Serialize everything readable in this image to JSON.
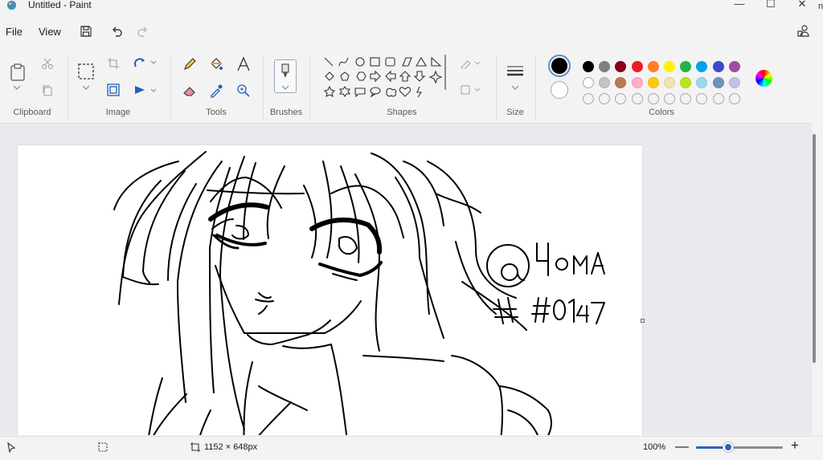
{
  "window": {
    "title": "Untitled - Paint",
    "minimize_glyph": "—",
    "maximize_glyph": "☐",
    "close_glyph": "✕",
    "edge_glyph": "n"
  },
  "menu": {
    "file": "File",
    "view": "View"
  },
  "ribbon": {
    "groups": {
      "clipboard": "Clipboard",
      "image": "Image",
      "tools": "Tools",
      "brushes": "Brushes",
      "shapes": "Shapes",
      "size": "Size",
      "colors": "Colors"
    },
    "shapes": [
      "line",
      "curve",
      "oval",
      "rectangle",
      "rounded-rectangle",
      "polygon",
      "triangle",
      "right-triangle",
      "diamond",
      "pentagon",
      "hexagon",
      "right-arrow",
      "left-arrow",
      "up-arrow",
      "down-arrow",
      "four-point-star",
      "five-point-star",
      "six-point-star",
      "rounded-callout",
      "oval-callout",
      "cloud-callout",
      "heart",
      "lightning"
    ],
    "colors": {
      "primary": "#000000",
      "secondary": "#ffffff",
      "palette_row1": [
        "#000000",
        "#7f7f7f",
        "#880015",
        "#ed1c24",
        "#ff7f27",
        "#fff200",
        "#22b14c",
        "#00a2e8",
        "#3f48cc",
        "#a349a4"
      ],
      "palette_row2": [
        "#ffffff",
        "#c3c3c3",
        "#b97a57",
        "#ffaec9",
        "#ffc90e",
        "#efe4b0",
        "#b5e61d",
        "#99d9ea",
        "#7092be",
        "#c8bfe7"
      ],
      "row2_empty_count": 0,
      "row3_empty_count": 10
    }
  },
  "canvas": {
    "signature_text": "@YoMA #0147"
  },
  "status": {
    "dimensions": "1152 × 648px",
    "zoom": "100%",
    "zoom_minus": "—",
    "zoom_plus": "+",
    "zoom_level": 0.37
  }
}
